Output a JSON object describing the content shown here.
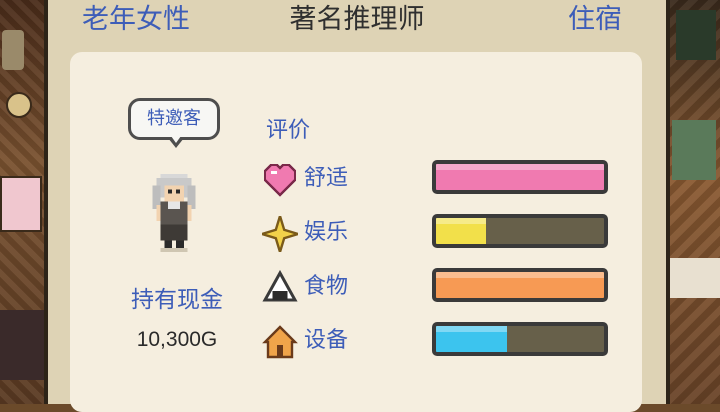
{
  "header": {
    "category": "老年女性",
    "occupation": "著名推理师",
    "stay_type": "住宿"
  },
  "guest": {
    "badge": "特邀客",
    "avatar_icon": "elderly-woman-sprite"
  },
  "cash": {
    "label": "持有现金",
    "value": "10,300G"
  },
  "ratings": {
    "title": "评价",
    "items": [
      {
        "label": "舒适",
        "icon": "heart-icon",
        "fill": 1.0,
        "color": "#f07ab0"
      },
      {
        "label": "娱乐",
        "icon": "sparkle-icon",
        "fill": 0.3,
        "color": "#f2e04a"
      },
      {
        "label": "食物",
        "icon": "rice-ball-icon",
        "fill": 1.0,
        "color": "#f79a54"
      },
      {
        "label": "设备",
        "icon": "house-icon",
        "fill": 0.42,
        "color": "#3cc4ee"
      }
    ]
  }
}
